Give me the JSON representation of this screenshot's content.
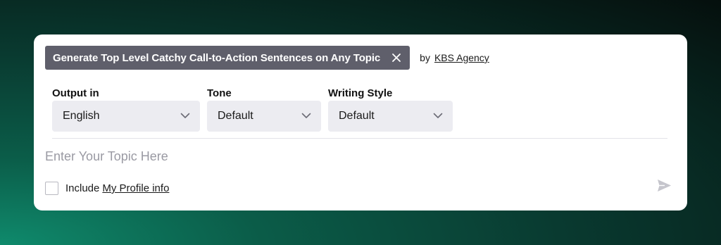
{
  "prompt": {
    "title": "Generate Top Level Catchy Call-to-Action Sentences on Any Topic",
    "by_label": "by",
    "author": "KBS Agency"
  },
  "selectors": [
    {
      "label": "Output in",
      "value": "English"
    },
    {
      "label": "Tone",
      "value": "Default"
    },
    {
      "label": "Writing Style",
      "value": "Default"
    }
  ],
  "topic": {
    "placeholder": "Enter Your Topic Here",
    "value": ""
  },
  "profile": {
    "include_label": "Include",
    "link_label": "My Profile info",
    "checked": false
  },
  "icons": {
    "close": "close-icon",
    "chevron": "chevron-down-icon",
    "send": "send-icon"
  },
  "colors": {
    "chip_bg": "#5f5f6b",
    "select_bg": "#ececf1",
    "send_icon": "#c5c5cc"
  }
}
